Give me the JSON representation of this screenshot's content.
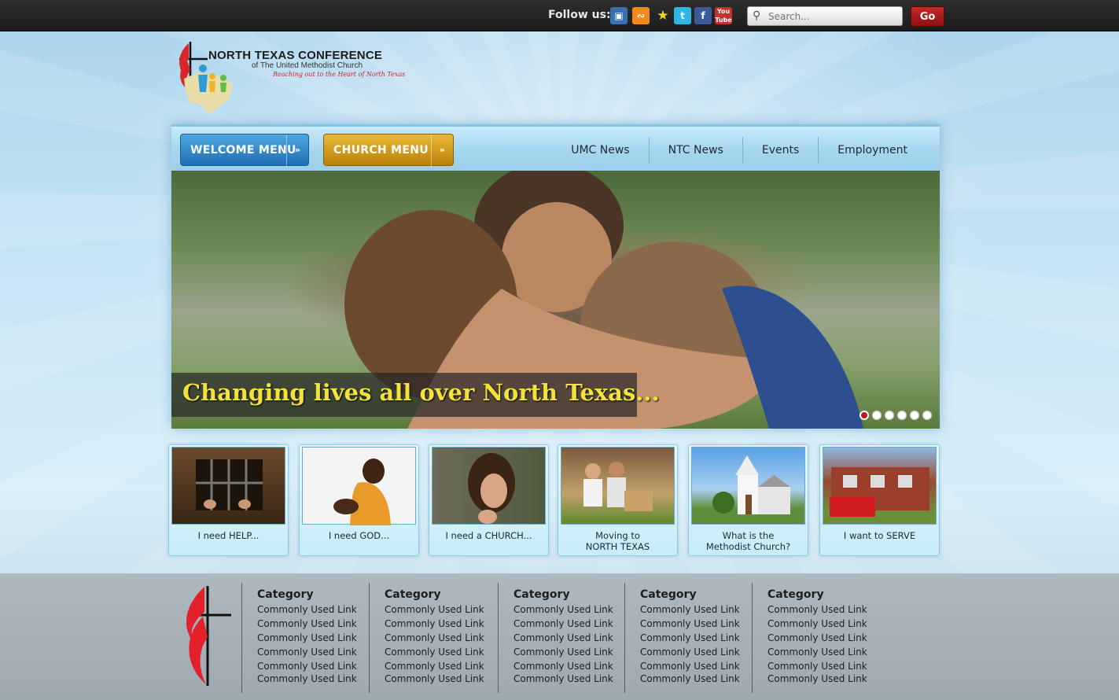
{
  "topbar": {
    "follow_label": "Follow us:",
    "social_icons": [
      "monitor-icon",
      "rss-icon",
      "star-icon",
      "twitter-icon",
      "facebook-icon",
      "youtube-icon"
    ],
    "search_placeholder": "Search...",
    "go_label": "Go"
  },
  "logo": {
    "title": "NORTH TEXAS CONFERENCE",
    "subtitle": "of The United Methodist Church",
    "tagline": "Reaching out to the Heart of North Texas"
  },
  "nav": {
    "welcome_menu": "WELCOME MENU",
    "church_menu": "CHURCH MENU",
    "links": [
      "UMC News",
      "NTC News",
      "Events",
      "Employment"
    ]
  },
  "hero": {
    "caption": "Changing lives all over North Texas...",
    "slide_count": 6,
    "active_slide": 1
  },
  "cards": [
    {
      "line1": "I need HELP...",
      "line2": ""
    },
    {
      "line1": "I need GOD...",
      "line2": ""
    },
    {
      "line1": "I need a CHURCH...",
      "line2": ""
    },
    {
      "line1": "Moving to",
      "line2": "NORTH TEXAS"
    },
    {
      "line1": "What is the",
      "line2": "Methodist Church?"
    },
    {
      "line1": "I  want to SERVE",
      "line2": ""
    }
  ],
  "footer": {
    "columns": [
      {
        "category": "Category",
        "links": [
          "Commonly Used Link",
          "Commonly Used Link",
          "Commonly Used Link",
          "Commonly Used Link",
          "Commonly Used Link",
          "Commonly Used Link"
        ]
      },
      {
        "category": "Category",
        "links": [
          "Commonly Used Link",
          "Commonly Used Link",
          "Commonly Used Link",
          "Commonly Used Link",
          "Commonly Used Link",
          "Commonly Used Link"
        ]
      },
      {
        "category": "Category",
        "links": [
          "Commonly Used Link",
          "Commonly Used Link",
          "Commonly Used Link",
          "Commonly Used Link",
          "Commonly Used Link",
          "Commonly Used Link"
        ]
      },
      {
        "category": "Category",
        "links": [
          "Commonly Used Link",
          "Commonly Used Link",
          "Commonly Used Link",
          "Commonly Used Link",
          "Commonly Used Link",
          "Commonly Used Link"
        ]
      },
      {
        "category": "Category",
        "links": [
          "Commonly Used Link",
          "Commonly Used Link",
          "Commonly Used Link",
          "Commonly Used Link",
          "Commonly Used Link",
          "Commonly Used Link"
        ]
      }
    ]
  },
  "colors": {
    "go_button": "#b41c1c",
    "welcome_menu": "#2d7fc2",
    "church_menu": "#d19d1c",
    "hero_caption": "#f3e23a",
    "active_dot": "#c31818"
  }
}
